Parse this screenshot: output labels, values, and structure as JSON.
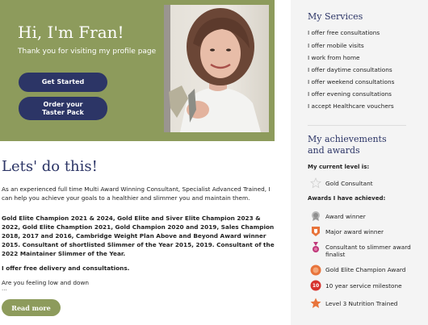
{
  "hero": {
    "title": "Hi, I'm Fran!",
    "subtitle": "Thank you for visiting my profile page",
    "start_label": "Get Started",
    "taster_label": "Order your Taster Pack"
  },
  "main": {
    "heading": "Lets' do this!",
    "intro": "As an experienced full time Multi Award Winning Consultant, Specialist Advanced Trained,  I can help you achieve your goals to a healthier and slimmer you and maintain them.",
    "awards_text": "Gold Elite Champion 2021 & 2024, Gold Elite and Siver Elite Champion 2023 & 2022, Gold Elite Chamption 2021, Gold Champion 2020 and 2019, Sales Champion 2018, 2017 and 2016, Cambridge Weight Plan Above and Beyond Award winner 2015. Consultant of shortlisted Slimmer of the Year 2015, 2019. Consultant of the 2022 Maintainer Slimmer of the Year.",
    "delivery": "I offer free delivery and consultations.",
    "feeling": "Are you feeling low and down",
    "ellipsis": "...",
    "read_more": "Read more"
  },
  "sidebar": {
    "services_title": "My Services",
    "services": [
      "I offer free consultations",
      "I offer mobile visits",
      "I work from home",
      "I offer daytime consultations",
      "I offer weekend consultations",
      "I offer evening consultations",
      "I accept Healthcare vouchers"
    ],
    "achievements_title_line1": "My achievements",
    "achievements_title_line2": "and awards",
    "current_level_label": "My current level is:",
    "current_level": "Gold Consultant",
    "awards_label": "Awards I have achieved:",
    "awards": [
      {
        "label": "Award winner",
        "icon": "rosette-icon",
        "color": "#9a9a9a"
      },
      {
        "label": "Major award winner",
        "icon": "major-award-icon",
        "color": "#e8743b"
      },
      {
        "label": "Consultant to slimmer award finalist",
        "icon": "medal-icon",
        "color": "#c0397a"
      },
      {
        "label": "Gold Elite Champion Award",
        "icon": "gold-elite-icon",
        "color": "#e8743b"
      },
      {
        "label": "10 year service milestone",
        "icon": "milestone-10-icon",
        "color": "#d6322e",
        "badge_text": "10"
      },
      {
        "label": "Level 3 Nutrition Trained",
        "icon": "star-badge-icon",
        "color": "#e8743b"
      }
    ]
  },
  "colors": {
    "olive": "#8d9b5c",
    "navy": "#2c3566",
    "sidebar_bg": "#f4f4f4"
  }
}
